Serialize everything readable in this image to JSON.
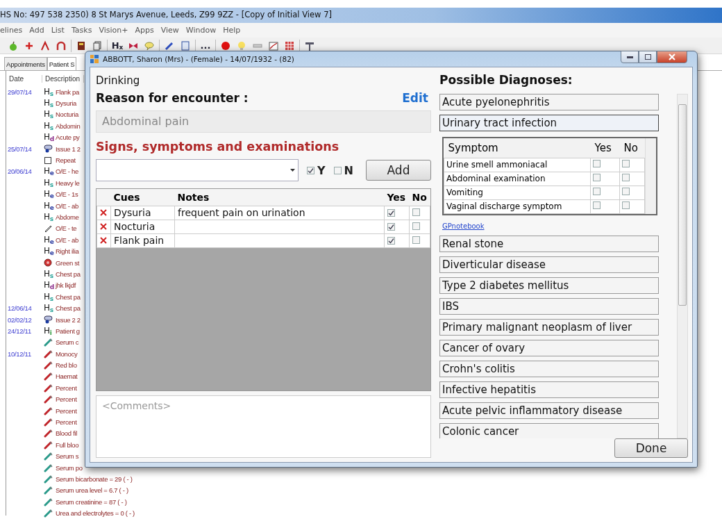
{
  "main_window": {
    "title": "HS No: 497 538 2350)  8 St Marys Avenue, Leeds, Z99 9ZZ - [Copy of Initial View 7]",
    "menu": [
      "elines",
      "Add",
      "List",
      "Tasks",
      "Vision+",
      "Apps",
      "View",
      "Window",
      "Help"
    ],
    "toolbar": [
      {
        "kind": "apple"
      },
      {
        "kind": "plus"
      },
      {
        "kind": "arrow"
      },
      {
        "kind": "horseshoe"
      },
      {
        "kind": "book"
      },
      {
        "kind": "pages"
      },
      {
        "kind": "rx",
        "label": "H",
        "sub": "x"
      },
      {
        "kind": "bowtie"
      },
      {
        "kind": "bubble"
      },
      {
        "kind": "pencil"
      },
      {
        "kind": "clipboard"
      },
      {
        "kind": "more",
        "label": "..."
      },
      {
        "kind": "circle"
      },
      {
        "kind": "bulb"
      },
      {
        "kind": "bar"
      },
      {
        "kind": "chart"
      },
      {
        "kind": "grid"
      },
      {
        "kind": "sign"
      }
    ],
    "tabs": [
      {
        "label": "Appointments",
        "selected": false
      },
      {
        "label": "Patient S",
        "selected": true
      }
    ],
    "journal": {
      "columns": [
        "Date",
        "Description"
      ],
      "rows": [
        {
          "date": "29/07/14",
          "kind": "h",
          "code": "H",
          "sub": "s",
          "color": "#2aa39a",
          "text": "Flank pa"
        },
        {
          "kind": "h",
          "code": "H",
          "sub": "s",
          "color": "#2aa39a",
          "text": "Dysuria"
        },
        {
          "kind": "h",
          "code": "H",
          "sub": "s",
          "color": "#2aa39a",
          "text": "Nocturia"
        },
        {
          "kind": "h",
          "code": "H",
          "sub": "s",
          "color": "#2aa39a",
          "text": "Abdomin"
        },
        {
          "kind": "h",
          "code": "H",
          "sub": "d",
          "color": "#8a2a8a",
          "text": "Acute py"
        },
        {
          "date": "25/07/14",
          "kind": "issue",
          "text": "Issue 1 2"
        },
        {
          "kind": "repeat",
          "text": "Repeat"
        },
        {
          "date": "20/06/14",
          "kind": "h",
          "code": "H",
          "sub": "e",
          "color": "#2a3aa0",
          "text": "O/E - he"
        },
        {
          "kind": "h",
          "code": "H",
          "sub": "s",
          "color": "#2aa39a",
          "text": "Heavy le"
        },
        {
          "kind": "h",
          "code": "H",
          "sub": "e",
          "color": "#2a3aa0",
          "text": "O/E - 1s"
        },
        {
          "kind": "h",
          "code": "H",
          "sub": "e",
          "color": "#2a3aa0",
          "text": "O/E - ab"
        },
        {
          "kind": "h",
          "code": "H",
          "sub": "s",
          "color": "#2aa39a",
          "text": "Abdome"
        },
        {
          "kind": "pencil",
          "text": "O/E - te"
        },
        {
          "kind": "h",
          "code": "H",
          "sub": "e",
          "color": "#2a3aa0",
          "text": "O/E - ab"
        },
        {
          "kind": "h",
          "code": "H",
          "sub": "e",
          "color": "#2a3aa0",
          "text": "Right ilia"
        },
        {
          "kind": "status",
          "text": "Green st"
        },
        {
          "kind": "h",
          "code": "H",
          "sub": "s",
          "color": "#2aa39a",
          "text": "Chest pa"
        },
        {
          "kind": "h",
          "code": "H",
          "sub": "d",
          "color": "#8a2a8a",
          "text": "jhk lkjdf"
        },
        {
          "kind": "h",
          "code": "H",
          "sub": "s",
          "color": "#2aa39a",
          "text": "Chest pa"
        },
        {
          "date": "12/06/14",
          "kind": "h",
          "code": "H",
          "sub": "s",
          "color": "#2aa39a",
          "text": "Chest pa"
        },
        {
          "date": "02/02/12",
          "kind": "issue",
          "text": "Issue 2 2"
        },
        {
          "date": "24/12/11",
          "kind": "h",
          "code": "H",
          "sub": "i",
          "color": "#2a9a3a",
          "text": "Patient g"
        },
        {
          "kind": "tube",
          "color": "#2a9a8a",
          "text": "Serum c"
        },
        {
          "date": "10/12/11",
          "kind": "tube",
          "color": "#c0242a",
          "text": "Monocy"
        },
        {
          "kind": "tube",
          "color": "#c0242a",
          "text": "Red blo"
        },
        {
          "kind": "tube",
          "color": "#c0242a",
          "text": "Haemat"
        },
        {
          "kind": "tube",
          "color": "#c0242a",
          "text": "Percent"
        },
        {
          "kind": "tube",
          "color": "#c0242a",
          "text": "Percent"
        },
        {
          "kind": "tube",
          "color": "#c0242a",
          "text": "Percent"
        },
        {
          "kind": "tube",
          "color": "#c0242a",
          "text": "Percent"
        },
        {
          "kind": "tube",
          "color": "#c0242a",
          "text": "Blood fil"
        },
        {
          "kind": "tube",
          "color": "#c0242a",
          "text": "Full bloo"
        },
        {
          "kind": "tube",
          "color": "#2a9a8a",
          "text": "Serum s"
        },
        {
          "kind": "tube",
          "color": "#2a9a8a",
          "text": "Serum po"
        },
        {
          "kind": "tube",
          "color": "#2a9a8a",
          "text": "Serum bicarbonate = 29  ( - )"
        },
        {
          "kind": "tube",
          "color": "#2a9a8a",
          "text": "Serum urea level = 6.7  ( - )"
        },
        {
          "kind": "tube",
          "color": "#2a9a8a",
          "text": "Serum creatinine = 87  ( - )"
        },
        {
          "kind": "tube",
          "color": "#2a9a8a",
          "text": "Urea and electrolytes = 0  ( - )"
        }
      ]
    }
  },
  "dialog": {
    "title": "ABBOTT, Sharon (Mrs)  - (Female) - 14/07/1932 - (82)",
    "context": "Drinking",
    "reason_label": "Reason for encounter :",
    "edit_link": "Edit",
    "reason_value": "Abdominal pain",
    "signs_heading": "Signs, symptoms and examinations",
    "yes_option": {
      "label": "Y",
      "checked": true
    },
    "no_option": {
      "label": "N",
      "checked": false
    },
    "add_button": "Add",
    "cues": {
      "columns": [
        "Cues",
        "Notes",
        "Yes",
        "No"
      ],
      "rows": [
        {
          "cue": "Dysuria",
          "notes": "frequent pain on urination",
          "yes": true,
          "no": false
        },
        {
          "cue": "Nocturia",
          "yes": true,
          "no": false
        },
        {
          "cue": "Flank pain",
          "yes": true,
          "no": false
        }
      ]
    },
    "comments": {
      "placeholder": "<Comments>"
    },
    "diagnoses_heading": "Possible Diagnoses:",
    "diagnoses": [
      {
        "name": "Acute pyelonephritis",
        "expanded": false
      },
      {
        "name": "Urinary tract infection",
        "expanded": true,
        "symptoms": {
          "columns": [
            "Symptom",
            "Yes",
            "No"
          ],
          "rows": [
            {
              "name": "Urine smell ammoniacal",
              "yes": false,
              "no": false
            },
            {
              "name": "Abdominal examination",
              "yes": false,
              "no": false
            },
            {
              "name": "Vomiting",
              "yes": false,
              "no": false
            },
            {
              "name": "Vaginal discharge symptom",
              "yes": false,
              "no": false
            }
          ]
        },
        "link": "GPnotebook"
      },
      {
        "name": "Renal stone",
        "expanded": false
      },
      {
        "name": "Diverticular disease",
        "expanded": false
      },
      {
        "name": "Type 2 diabetes mellitus",
        "expanded": false
      },
      {
        "name": "IBS",
        "expanded": false
      },
      {
        "name": "Primary malignant neoplasm of liver",
        "expanded": false
      },
      {
        "name": "Cancer of ovary",
        "expanded": false
      },
      {
        "name": "Crohn's colitis",
        "expanded": false
      },
      {
        "name": "Infective hepatitis",
        "expanded": false
      },
      {
        "name": "Acute pelvic inflammatory disease",
        "expanded": false
      },
      {
        "name": "Colonic cancer",
        "expanded": false
      }
    ],
    "done_button": "Done"
  }
}
